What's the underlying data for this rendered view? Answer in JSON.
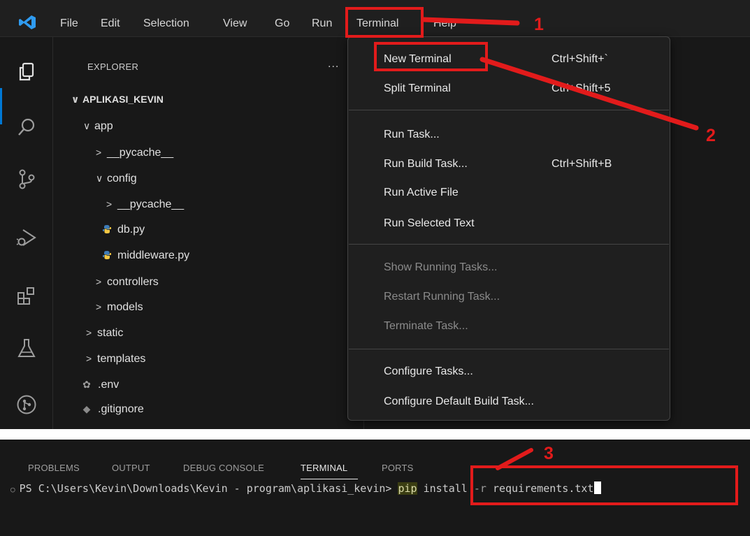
{
  "menubar": {
    "items": [
      "File",
      "Edit",
      "Selection",
      "View",
      "Go",
      "Run",
      "Terminal",
      "Help"
    ]
  },
  "explorer": {
    "title": "EXPLORER",
    "more": "...",
    "tree": [
      {
        "label": "APLIKASI_KEVIN",
        "chevron": "∨",
        "icon": "none"
      },
      {
        "label": "app",
        "chevron": "∨",
        "icon": "none"
      },
      {
        "label": "__pycache__",
        "chevron": ">",
        "icon": "none"
      },
      {
        "label": "config",
        "chevron": "∨",
        "icon": "none"
      },
      {
        "label": "__pycache__",
        "chevron": ">",
        "icon": "none"
      },
      {
        "label": "db.py",
        "chevron": "",
        "icon": "python-file-icon"
      },
      {
        "label": "middleware.py",
        "chevron": "",
        "icon": "python-file-icon"
      },
      {
        "label": "controllers",
        "chevron": ">",
        "icon": "none"
      },
      {
        "label": "models",
        "chevron": ">",
        "icon": "none"
      },
      {
        "label": "static",
        "chevron": ">",
        "icon": "none"
      },
      {
        "label": "templates",
        "chevron": ">",
        "icon": "none"
      },
      {
        "label": ".env",
        "chevron": "",
        "icon": "gear-file-icon"
      },
      {
        "label": ".gitignore",
        "chevron": "",
        "icon": "git-file-icon"
      }
    ]
  },
  "terminal_menu": {
    "items": [
      {
        "label": "New Terminal",
        "shortcut": "Ctrl+Shift+`",
        "disabled": false
      },
      {
        "label": "Split Terminal",
        "shortcut": "Ctrl+Shift+5",
        "disabled": false
      },
      {
        "label": "Run Task...",
        "shortcut": "",
        "disabled": false
      },
      {
        "label": "Run Build Task...",
        "shortcut": "Ctrl+Shift+B",
        "disabled": false
      },
      {
        "label": "Run Active File",
        "shortcut": "",
        "disabled": false
      },
      {
        "label": "Run Selected Text",
        "shortcut": "",
        "disabled": false
      },
      {
        "label": "Show Running Tasks...",
        "shortcut": "",
        "disabled": true
      },
      {
        "label": "Restart Running Task...",
        "shortcut": "",
        "disabled": true
      },
      {
        "label": "Terminate Task...",
        "shortcut": "",
        "disabled": true
      },
      {
        "label": "Configure Tasks...",
        "shortcut": "",
        "disabled": false
      },
      {
        "label": "Configure Default Build Task...",
        "shortcut": "",
        "disabled": false
      }
    ]
  },
  "panel": {
    "tabs": [
      "PROBLEMS",
      "OUTPUT",
      "DEBUG CONSOLE",
      "TERMINAL",
      "PORTS"
    ],
    "active_tab": "TERMINAL",
    "prompt": "PS C:\\Users\\Kevin\\Downloads\\Kevin - program\\aplikasi_kevin>",
    "command_pip": "pip",
    "command_install": "install",
    "command_flag": "-r",
    "command_file": "requirements.txt"
  },
  "annotations": {
    "step1": "1",
    "step2": "2",
    "step3": "3",
    "color": "#e21b1b"
  },
  "colors": {
    "background": "#181818",
    "menu_bg": "#1f1f1f",
    "accent": "#0078d4",
    "disabled_text": "#8b8b8b"
  }
}
